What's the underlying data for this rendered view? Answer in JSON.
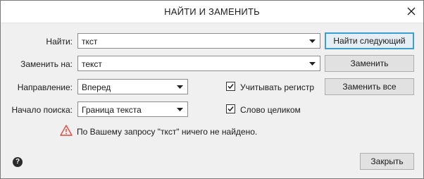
{
  "dialog": {
    "title": "НАЙТИ И ЗАМЕНИТЬ",
    "close_icon": "close-icon"
  },
  "fields": {
    "find_label": "Найти:",
    "find_value": "ткст",
    "replace_label": "Заменить на:",
    "replace_value": "текст",
    "direction_label": "Направление:",
    "direction_value": "Вперед",
    "start_label": "Начало поиска:",
    "start_value": "Граница текста"
  },
  "options": {
    "match_case_label": "Учитывать регистр",
    "match_case_checked": true,
    "whole_word_label": "Слово целиком",
    "whole_word_checked": true
  },
  "buttons": {
    "find_next": "Найти следующий",
    "replace": "Заменить",
    "replace_all": "Заменить все",
    "close": "Закрыть"
  },
  "status": {
    "icon": "warning-icon",
    "message": "По Вашему запросу \"ткст\" ничего не найдено."
  },
  "help": {
    "icon": "help-icon",
    "glyph": "?"
  },
  "colors": {
    "accent": "#3c9fd0",
    "warning": "#e04a3f"
  }
}
